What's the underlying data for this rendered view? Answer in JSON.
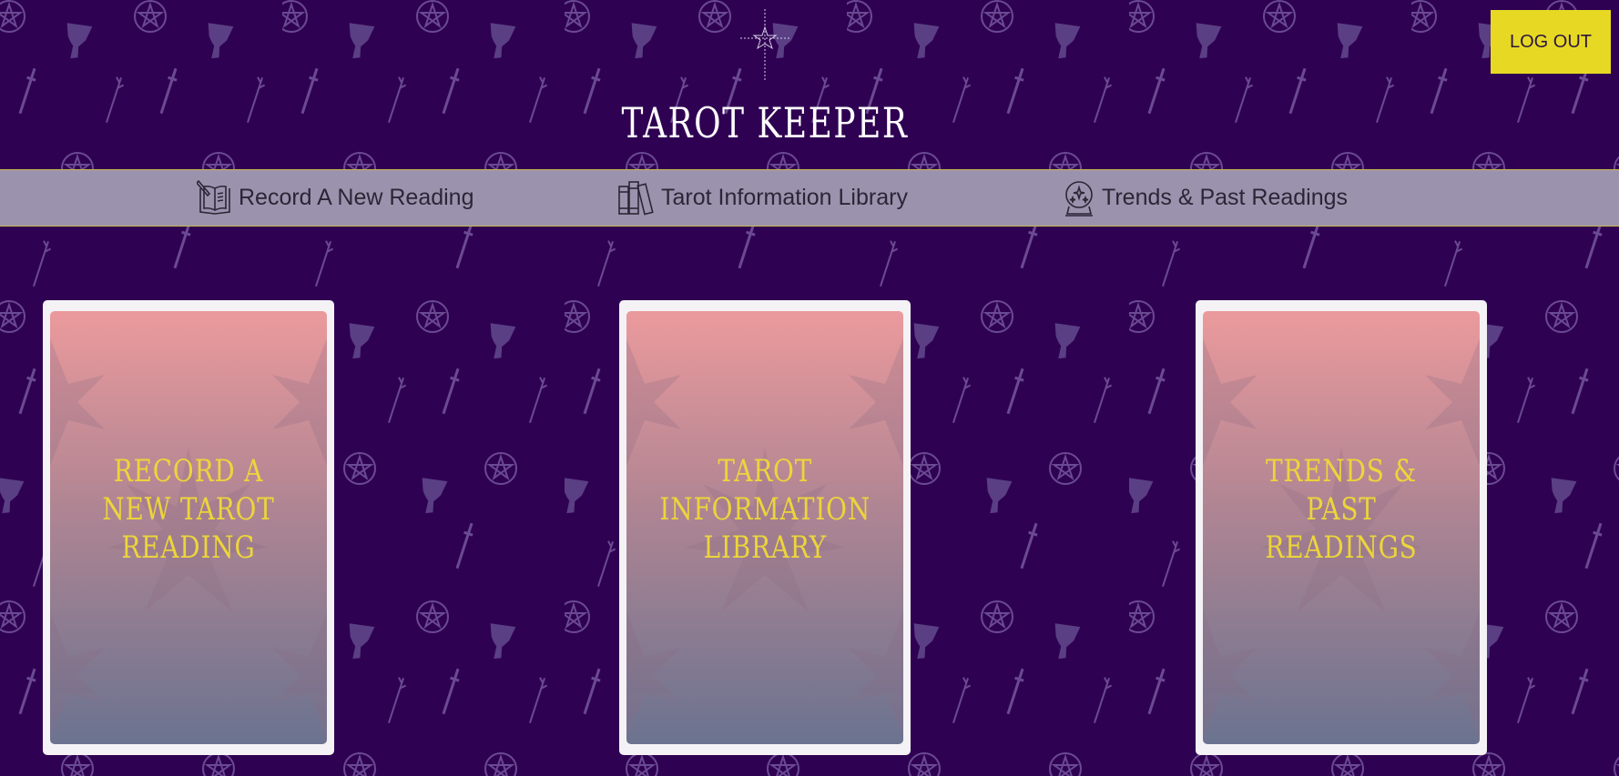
{
  "header": {
    "title": "TAROT KEEPER",
    "logo_icon": "compass-star-icon",
    "logout_label": "LOG OUT"
  },
  "nav": {
    "items": [
      {
        "label": "Record A New Reading",
        "icon": "open-book-quill-icon"
      },
      {
        "label": "Tarot Information Library",
        "icon": "books-icon"
      },
      {
        "label": "Trends & Past Readings",
        "icon": "crystal-ball-icon"
      }
    ]
  },
  "cards": [
    {
      "label": "RECORD A NEW TAROT READING"
    },
    {
      "label": "TAROT INFORMATION LIBRARY"
    },
    {
      "label": "TRENDS & PAST READINGS"
    }
  ],
  "colors": {
    "background": "#2f0152",
    "navbar": "#9b93ad",
    "accent_yellow": "#e7d923",
    "card_gradient_top": "#eb9a9c",
    "card_gradient_bottom": "#6b7390"
  }
}
